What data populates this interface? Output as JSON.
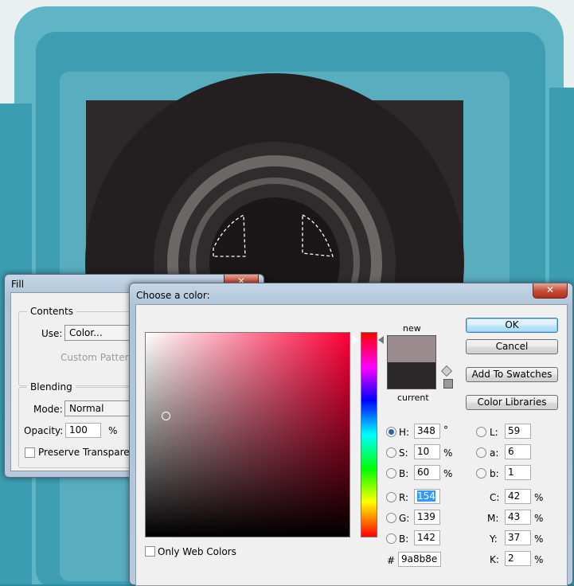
{
  "fill_dialog": {
    "title": "Fill",
    "close_symbol": "✕",
    "contents_group": "Contents",
    "use_label": "Use:",
    "use_value": "Color...",
    "custom_pattern_label": "Custom Pattern",
    "blending_group": "Blending",
    "mode_label": "Mode:",
    "mode_value": "Normal",
    "opacity_label": "Opacity:",
    "opacity_value": "100",
    "opacity_unit": "%",
    "preserve_label": "Preserve Transparency"
  },
  "color_picker": {
    "title": "Choose a color:",
    "close_symbol": "✕",
    "new_label": "new",
    "current_label": "current",
    "new_color": "#9a8b8e",
    "current_color": "#2b2628",
    "hue_color": "#ff0036",
    "buttons": {
      "ok": "OK",
      "cancel": "Cancel",
      "add_to_swatches": "Add To Swatches",
      "color_libraries": "Color Libraries"
    },
    "hsb": {
      "h_label": "H:",
      "h_value": "348",
      "h_unit": "°",
      "s_label": "S:",
      "s_value": "10",
      "s_unit": "%",
      "b_label": "B:",
      "b_value": "60",
      "b_unit": "%"
    },
    "rgb": {
      "r_label": "R:",
      "r_value": "154",
      "g_label": "G:",
      "g_value": "139",
      "b_label": "B:",
      "b_value": "142"
    },
    "lab": {
      "l_label": "L:",
      "l_value": "59",
      "a_label": "a:",
      "a_value": "6",
      "b_label": "b:",
      "b_value": "1"
    },
    "cmyk": {
      "c_label": "C:",
      "c_value": "42",
      "c_unit": "%",
      "m_label": "M:",
      "m_value": "43",
      "m_unit": "%",
      "y_label": "Y:",
      "y_value": "37",
      "y_unit": "%",
      "k_label": "K:",
      "k_value": "2",
      "k_unit": "%"
    },
    "hex_label": "#",
    "hex_value": "9a8b8e",
    "web_colors_label": "Only Web Colors",
    "selected_mode": "H"
  }
}
